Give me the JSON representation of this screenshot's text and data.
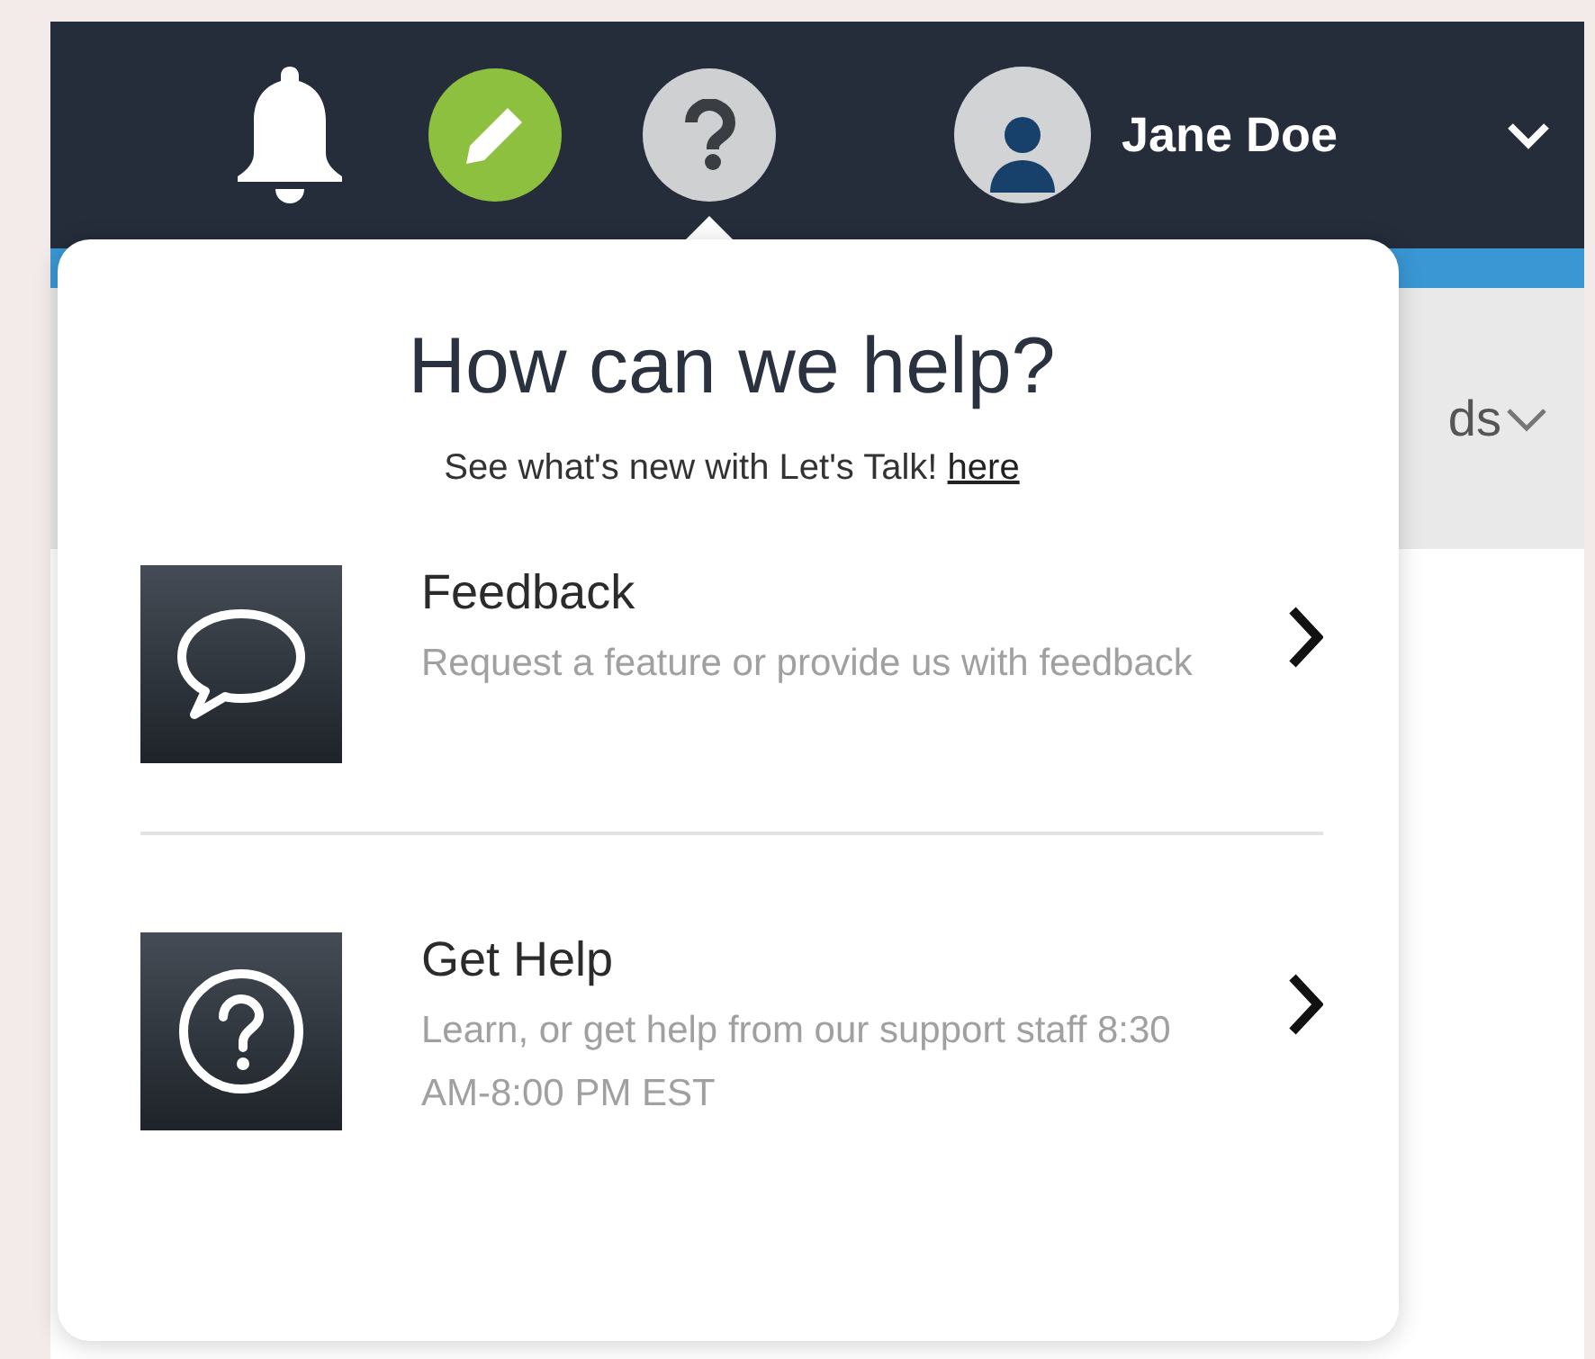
{
  "header": {
    "user_name": "Jane Doe"
  },
  "background": {
    "tab_fragment": "ds"
  },
  "help_menu": {
    "title": "How can we help?",
    "subtitle": "See what's new with Let's Talk!",
    "subtitle_link": "here",
    "options": [
      {
        "kind": "feedback",
        "title": "Feedback",
        "description": "Request a feature or provide us with feedback"
      },
      {
        "kind": "help",
        "title": "Get Help",
        "description": "Learn, or get help from our support staff 8:30 AM-8:00 PM EST"
      }
    ]
  }
}
